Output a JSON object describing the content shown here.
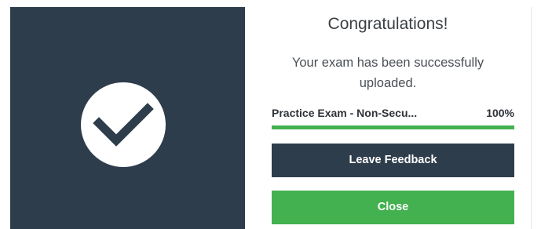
{
  "dialog": {
    "title": "Congratulations!",
    "message": "Your exam has been successfully uploaded.",
    "status_icon": "checkmark-icon",
    "upload": {
      "name": "Practice Exam - Non-Secu...",
      "percent_label": "100%",
      "progress": 1.0
    },
    "buttons": {
      "feedback_label": "Leave Feedback",
      "close_label": "Close"
    }
  },
  "colors": {
    "panel_dark": "#2e3d4c",
    "accent_green": "#43b14f",
    "icon_bg": "#ffffff"
  }
}
